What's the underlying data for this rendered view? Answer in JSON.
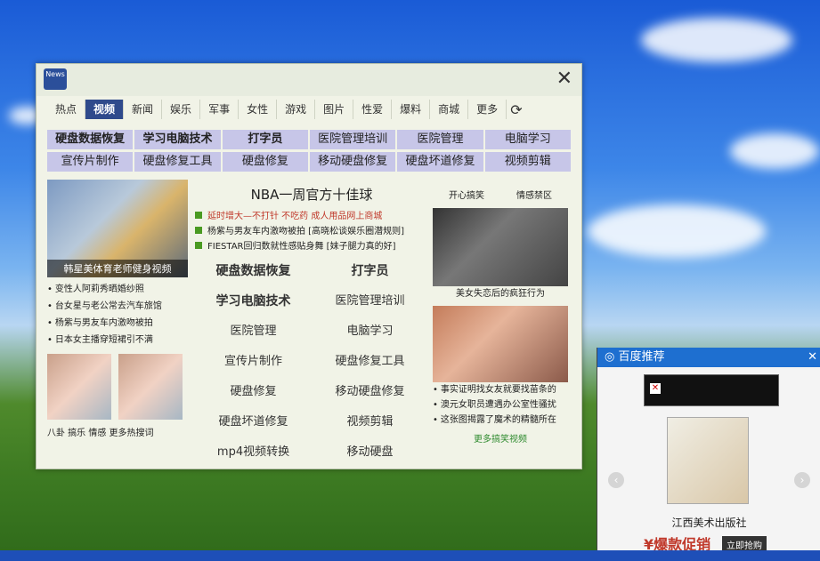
{
  "news": {
    "logo_text": "News",
    "tabs": [
      "热点",
      "视频",
      "新闻",
      "娱乐",
      "军事",
      "女性",
      "游戏",
      "图片",
      "性爱",
      "爆料",
      "商城",
      "更多"
    ],
    "active_tab": "视频",
    "keywords_row1": [
      "硬盘数据恢复",
      "学习电脑技术",
      "打字员",
      "医院管理培训",
      "医院管理",
      "电脑学习"
    ],
    "keywords_row2": [
      "宣传片制作",
      "硬盘修复工具",
      "硬盘修复",
      "移动硬盘修复",
      "硬盘坏道修复",
      "视频剪辑"
    ],
    "left": {
      "thumb_caption": "韩星美体育老师健身视频",
      "list": [
        "变性人阿莉秀晒婚纱照",
        "台女星与老公常去汽车旅馆",
        "杨紫与男友车内激吻被拍",
        "日本女主播穿短裙引不满"
      ],
      "bottom_tags": "八卦 搞乐 情感 更多热搜词"
    },
    "mid": {
      "headline": "NBA一周官方十佳球",
      "items": [
        "延时增大—不打针 不吃药 成人用品网上商城",
        "杨紫与男友车内激吻被拍 [高晓松谈娱乐圈潜规则]",
        "FIESTAR回归数就性感贴身舞 [妹子腿力真的好]"
      ],
      "links": [
        "硬盘数据恢复",
        "打字员",
        "学习电脑技术",
        "医院管理培训",
        "医院管理",
        "电脑学习",
        "宣传片制作",
        "硬盘修复工具",
        "硬盘修复",
        "移动硬盘修复",
        "硬盘坏道修复",
        "视频剪辑",
        "mp4视频转换",
        "移动硬盘"
      ]
    },
    "right": {
      "tabs": [
        "开心搞笑",
        "情感禁区"
      ],
      "cap1": "美女失恋后的疯狂行为",
      "list": [
        "事实证明找女友就要找苗条的",
        "澳元女职员遭遇办公室性骚扰",
        "这张图揭露了魔术的精髓所在"
      ],
      "more": "更多搞笑视频"
    }
  },
  "baidu": {
    "title": "百度推荐",
    "product_name": "江西美术出版社",
    "promo": "¥爆款促销",
    "buy_label": "立即抢购"
  }
}
